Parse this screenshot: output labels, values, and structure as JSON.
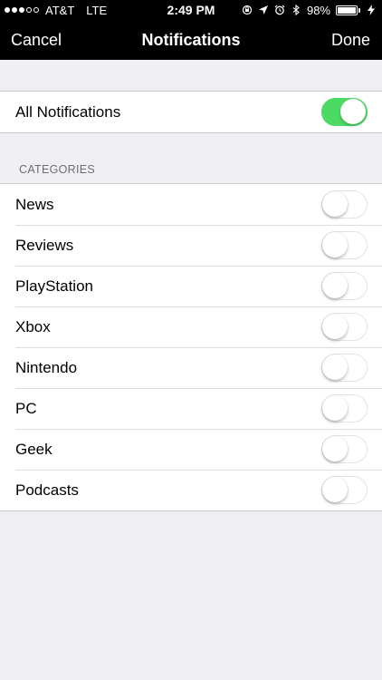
{
  "status_bar": {
    "carrier": "AT&T",
    "network": "LTE",
    "time": "2:49 PM",
    "battery": "98%",
    "battery_level": 0.98,
    "signal_bars_filled": 3,
    "signal_bars_total": 5
  },
  "nav": {
    "cancel_label": "Cancel",
    "title": "Notifications",
    "done_label": "Done"
  },
  "all_notifications": {
    "label": "All Notifications",
    "on": true
  },
  "categories": {
    "header": "CATEGORIES",
    "items": [
      {
        "label": "News",
        "on": false
      },
      {
        "label": "Reviews",
        "on": false
      },
      {
        "label": "PlayStation",
        "on": false
      },
      {
        "label": "Xbox",
        "on": false
      },
      {
        "label": "Nintendo",
        "on": false
      },
      {
        "label": "PC",
        "on": false
      },
      {
        "label": "Geek",
        "on": false
      },
      {
        "label": "Podcasts",
        "on": false
      }
    ]
  },
  "colors": {
    "toggle_on": "#4cd964",
    "background": "#efeff4",
    "bar": "#000000"
  }
}
